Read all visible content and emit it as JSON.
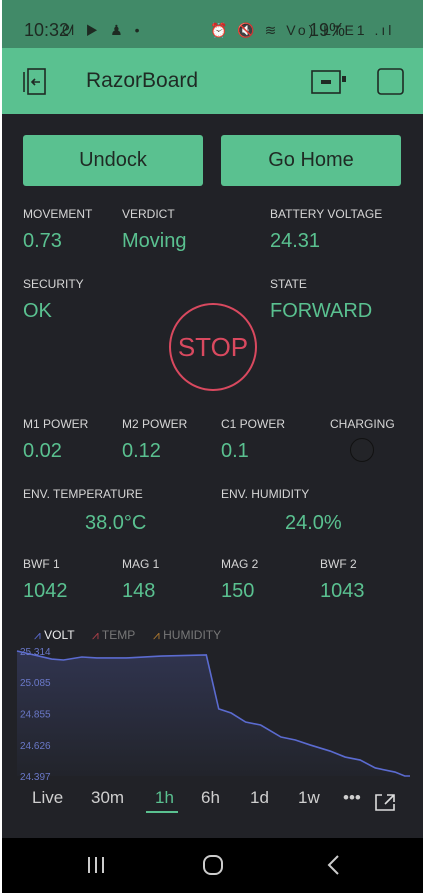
{
  "status_bar": {
    "time": "10:32",
    "icons": "ᘛ ▶ ♟ •",
    "right_icons": "⏰ 🔇 ≋ Vo) LTE1 .ıl",
    "battery": "19%"
  },
  "app_bar": {
    "title": "RazorBoard"
  },
  "buttons": {
    "undock": "Undock",
    "go_home": "Go Home",
    "stop": "STOP"
  },
  "metrics": [
    {
      "label": "MOVEMENT",
      "value": "0.73"
    },
    {
      "label": "VERDICT",
      "value": "Moving"
    },
    {
      "label": "BATTERY VOLTAGE",
      "value": "24.31"
    },
    {
      "label": "SECURITY",
      "value": "OK"
    },
    {
      "label": "STATE",
      "value": "FORWARD"
    },
    {
      "label": "M1 POWER",
      "value": "0.02"
    },
    {
      "label": "M2 POWER",
      "value": "0.12"
    },
    {
      "label": "C1 POWER",
      "value": "0.1"
    },
    {
      "label": "CHARGING",
      "value": ""
    },
    {
      "label": "ENV. TEMPERATURE",
      "value": "38.0°C"
    },
    {
      "label": "ENV. HUMIDITY",
      "value": "24.0%"
    },
    {
      "label": "BWF 1",
      "value": "1042"
    },
    {
      "label": "MAG 1",
      "value": "148"
    },
    {
      "label": "MAG 2",
      "value": "150"
    },
    {
      "label": "BWF 2",
      "value": "1043"
    }
  ],
  "chart_data": {
    "type": "area",
    "legend": [
      {
        "name": "VOLT",
        "color": "#5b6bd0",
        "active": true
      },
      {
        "name": "TEMP",
        "color": "#b0404a",
        "active": false
      },
      {
        "name": "HUMIDITY",
        "color": "#b07a30",
        "active": false
      }
    ],
    "yticks": [
      "25.314",
      "25.085",
      "24.855",
      "24.626",
      "24.397"
    ],
    "ylim": [
      24.397,
      25.314
    ],
    "xlim": [
      0,
      60
    ],
    "x": [
      0,
      5.3,
      7.1,
      9.9,
      12.2,
      16.7,
      22,
      28.9,
      30.8,
      32.7,
      34.9,
      37.2,
      40.3,
      42.5,
      44.8,
      47.8,
      50.1,
      52.4,
      54.7,
      57.7,
      59.2,
      60
    ],
    "values": [
      25.314,
      25.255,
      25.248,
      25.27,
      25.263,
      25.263,
      25.277,
      25.285,
      24.889,
      24.859,
      24.793,
      24.771,
      24.683,
      24.661,
      24.624,
      24.58,
      24.536,
      24.514,
      24.456,
      24.426,
      24.397,
      24.397
    ]
  },
  "time_tabs": [
    "Live",
    "30m",
    "1h",
    "6h",
    "1d",
    "1w",
    "•••"
  ],
  "selected_tab": "1h"
}
